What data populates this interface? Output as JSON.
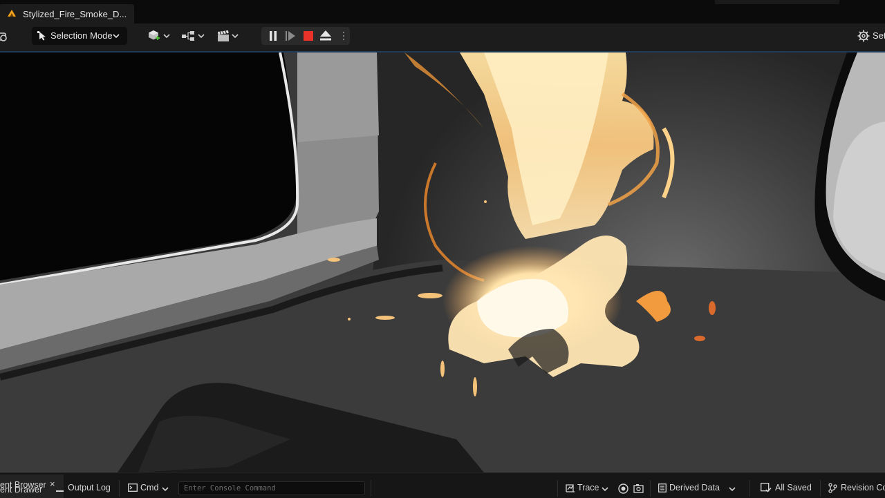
{
  "tab": {
    "title": "Stylized_Fire_Smoke_D..."
  },
  "toolbar": {
    "selection_mode_label": "Selection Mode",
    "settings_label": "Set",
    "play_controls": [
      "pause",
      "step-forward",
      "stop",
      "eject"
    ]
  },
  "statusbar": {
    "content_browser_label": "ent Browser",
    "content_drawer_label": "ent Drawer",
    "close_glyph": "×",
    "output_log_label": "Output Log",
    "cmd_label": "Cmd",
    "console_placeholder": "Enter Console Command",
    "trace_label": "Trace",
    "derived_data_label": "Derived Data",
    "all_saved_label": "All Saved",
    "revision_control_label": "Revision Co"
  },
  "colors": {
    "accent_orange": "#f0a21b",
    "stop_red": "#e8322a",
    "add_green": "#4fbf3a",
    "fire_core": "#fff3c8",
    "fire_mid": "#f7c27a",
    "fire_edge": "#d2691e"
  }
}
